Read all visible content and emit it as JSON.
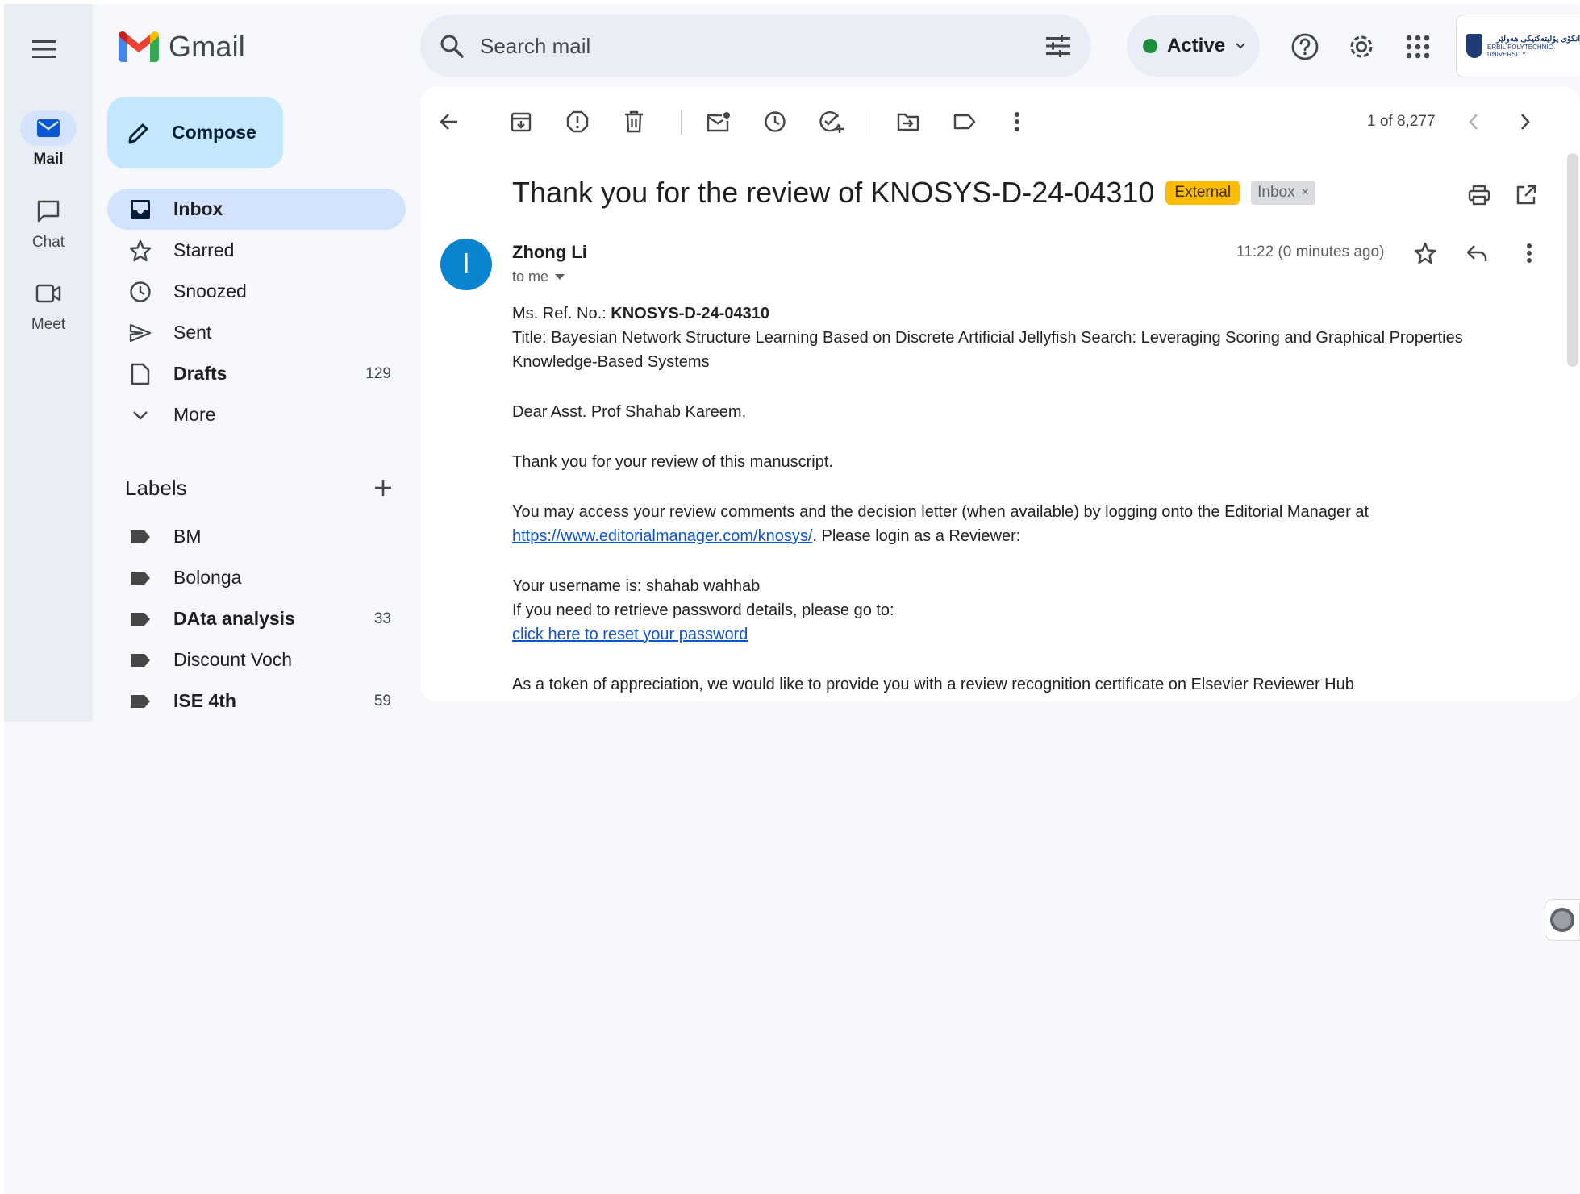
{
  "app": {
    "name": "Gmail"
  },
  "rail": {
    "items": [
      {
        "label": "Mail",
        "icon": "mail-icon",
        "active": true
      },
      {
        "label": "Chat",
        "icon": "chat-icon"
      },
      {
        "label": "Meet",
        "icon": "video-icon"
      }
    ]
  },
  "search": {
    "placeholder": "Search mail"
  },
  "status": {
    "label": "Active",
    "color": "#1e8e3e"
  },
  "org": {
    "line1": "زانکۆی پۆلیتەکنیکی هەولێر",
    "line2": "ERBIL POLYTECHNIC UNIVERSITY"
  },
  "compose": {
    "label": "Compose"
  },
  "nav": [
    {
      "label": "Inbox",
      "count": "",
      "icon": "inbox-icon"
    },
    {
      "label": "Starred",
      "count": "",
      "icon": "star-icon"
    },
    {
      "label": "Snoozed",
      "count": "",
      "icon": "clock-icon"
    },
    {
      "label": "Sent",
      "count": "",
      "icon": "send-icon"
    },
    {
      "label": "Drafts",
      "count": "129",
      "icon": "draft-icon"
    },
    {
      "label": "More",
      "count": "",
      "icon": "chevron-down-icon"
    }
  ],
  "labels": {
    "title": "Labels",
    "items": [
      {
        "label": "BM",
        "count": ""
      },
      {
        "label": "Bolonga",
        "count": ""
      },
      {
        "label": "DAta analysis",
        "count": "33"
      },
      {
        "label": "Discount Voch",
        "count": ""
      },
      {
        "label": "ISE 4th",
        "count": "59"
      }
    ]
  },
  "toolbar": {
    "pager": "1 of 8,277"
  },
  "message": {
    "subject": "Thank you for the review of KNOSYS-D-24-04310",
    "badge_external": "External",
    "badge_inbox": "Inbox",
    "sender": "Zhong Li",
    "avatar_letter": "l",
    "to": "to me",
    "time": "11:22 (0 minutes ago)",
    "ref_label": "Ms. Ref. No.: ",
    "ref_value": "KNOSYS-D-24-04310",
    "title_line": "Title: Bayesian Network Structure Learning Based on Discrete Artificial Jellyfish Search: Leveraging Scoring and Graphical Properties",
    "journal": "Knowledge-Based Systems",
    "greeting": "Dear Asst. Prof Shahab Kareem,",
    "thanks": "Thank you for your review of this manuscript.",
    "access_text": "You may access your review comments and the decision letter (when available) by logging onto the Editorial Manager at",
    "link_url": "https://www.editorialmanager.com/knosys/",
    "after_link": ". Please login as a Reviewer:",
    "username": "Your username is: shahab wahhab",
    "password_help": "If you need to retrieve password details, please go to:",
    "reset_link": "click here to reset your password",
    "appreciation": "As a token of appreciation, we would like to provide you with a review recognition certificate on Elsevier Reviewer Hub"
  }
}
